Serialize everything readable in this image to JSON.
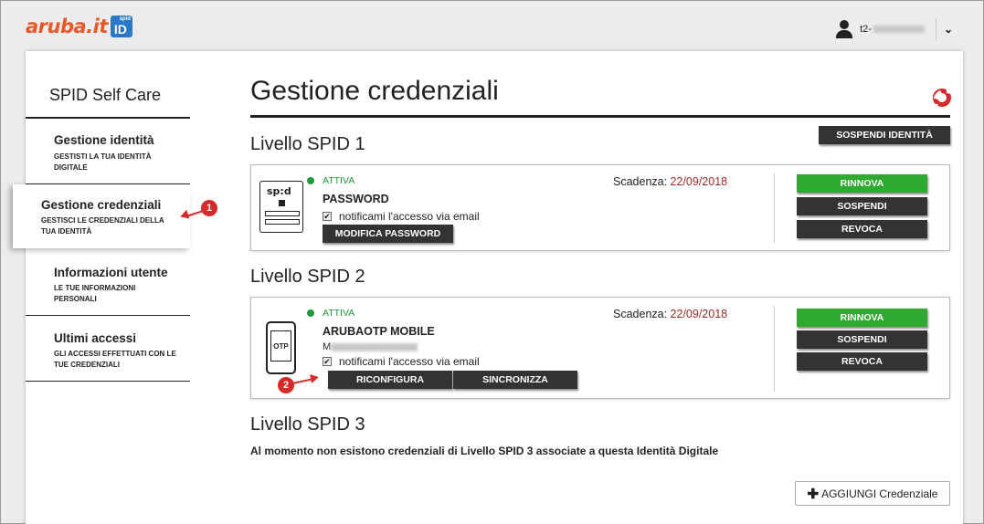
{
  "header": {
    "logo_text": "aruba.it",
    "logo_badge_small": "spid",
    "logo_badge_big": "ID",
    "user_prefix": "t2-",
    "chevron": "⌄"
  },
  "sidebar": {
    "title": "SPID Self Care",
    "items": [
      {
        "title": "Gestione identità",
        "subtitle": "GESTISTI LA TUA IDENTITÀ DIGITALE"
      },
      {
        "title": "Gestione credenziali",
        "subtitle": "GESTISCI LE CREDENZIALI DELLA TUA IDENTITÀ"
      },
      {
        "title": "Informazioni utente",
        "subtitle": "LE TUE INFORMAZIONI PERSONALI"
      },
      {
        "title": "Ultimi accessi",
        "subtitle": "GLI ACCESSI EFFETTUATI CON LE TUE CREDENZIALI"
      }
    ]
  },
  "markers": {
    "m1": "1",
    "m2": "2"
  },
  "main": {
    "title": "Gestione credenziali",
    "suspend_identity": "SOSPENDI IDENTITÀ",
    "level1": {
      "heading": "Livello SPID 1",
      "device_label": "sp:d",
      "status": "ATTIVA",
      "name": "PASSWORD",
      "notify": "notificami l'accesso via email",
      "expiry_label": "Scadenza: ",
      "expiry_date": "22/09/2018",
      "modify_btn": "MODIFICA PASSWORD",
      "renew": "RINNOVA",
      "suspend": "SOSPENDI",
      "revoke": "REVOCA"
    },
    "level2": {
      "heading": "Livello SPID 2",
      "device_label": "OTP",
      "status": "ATTIVA",
      "name": "ARUBAOTP MOBILE",
      "sub_prefix": "M",
      "notify": "notificami l'accesso via email",
      "expiry_label": "Scadenza: ",
      "expiry_date": "22/09/2018",
      "reconfig_btn": "RICONFIGURA",
      "sync_btn": "SINCRONIZZA",
      "renew": "RINNOVA",
      "suspend": "SOSPENDI",
      "revoke": "REVOCA"
    },
    "level3": {
      "heading": "Livello SPID 3",
      "message": "Al momento non esistono credenziali di Livello SPID 3 associate a questa Identità Digitale"
    },
    "add_button": "AGGIUNGI Credenziale"
  },
  "colors": {
    "accent_red": "#d42a2a",
    "green": "#2eaa2e",
    "status_green": "#1e9a3a",
    "date_red": "#a02a2a"
  }
}
